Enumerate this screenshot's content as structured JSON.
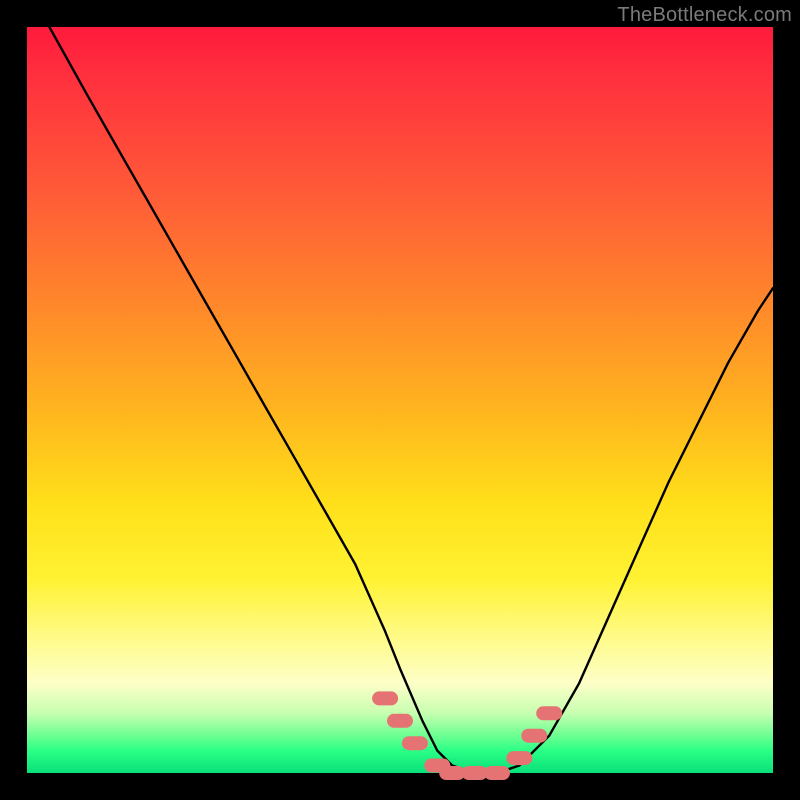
{
  "watermark": "TheBottleneck.com",
  "chart_data": {
    "type": "line",
    "title": "",
    "xlabel": "",
    "ylabel": "",
    "xlim": [
      0,
      100
    ],
    "ylim": [
      0,
      100
    ],
    "grid": false,
    "legend": false,
    "series": [
      {
        "name": "curve",
        "color": "#000000",
        "x": [
          3,
          8,
          12,
          16,
          20,
          24,
          28,
          32,
          36,
          40,
          44,
          48,
          50,
          53,
          55,
          57,
          60,
          63,
          66,
          70,
          74,
          78,
          82,
          86,
          90,
          94,
          98,
          100
        ],
        "y": [
          100,
          91,
          84,
          77,
          70,
          63,
          56,
          49,
          42,
          35,
          28,
          19,
          14,
          7,
          3,
          1,
          0,
          0,
          1,
          5,
          12,
          21,
          30,
          39,
          47,
          55,
          62,
          65
        ]
      }
    ],
    "markers": [
      {
        "name": "highlight-dots",
        "color": "#e57373",
        "shape": "round-rect",
        "points": [
          {
            "x": 48,
            "y": 10
          },
          {
            "x": 50,
            "y": 7
          },
          {
            "x": 52,
            "y": 4
          },
          {
            "x": 55,
            "y": 1
          },
          {
            "x": 57,
            "y": 0
          },
          {
            "x": 60,
            "y": 0
          },
          {
            "x": 63,
            "y": 0
          },
          {
            "x": 66,
            "y": 2
          },
          {
            "x": 68,
            "y": 5
          },
          {
            "x": 70,
            "y": 8
          }
        ]
      }
    ],
    "background_gradient": {
      "top": "#ff1a3c",
      "mid": "#ffe01a",
      "bottom": "#09e07a"
    }
  }
}
